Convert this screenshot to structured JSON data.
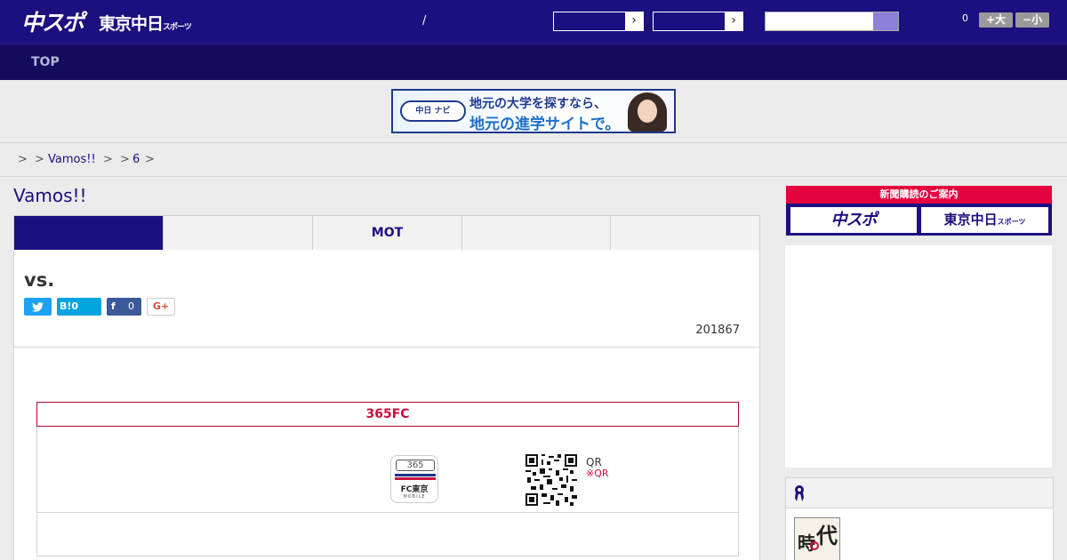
{
  "header": {
    "logo_chuspo": "中スポ",
    "logo_tokyo": "東京中日",
    "logo_tokyo_small": "スポーツ",
    "slash": "/",
    "select_arrow": "›",
    "font_size_count": "0",
    "font_up_label": "+大",
    "font_down_label": "−小"
  },
  "nav": {
    "top_label": "TOP"
  },
  "ad": {
    "logo_text": "中日 ナビ",
    "line1": "地元の大学を探すなら、",
    "line2": "地元の進学サイトで。"
  },
  "breadcrumb": {
    "sep1": ">",
    "sep2": ">",
    "vamos": "Vamos!!",
    "sep3": ">",
    "sep4": ">",
    "six": "6",
    "sep5": ">"
  },
  "page": {
    "title": "Vamos!!"
  },
  "tabs": [
    "",
    "",
    "MOT",
    "",
    ""
  ],
  "article": {
    "vs": "vs.",
    "share": {
      "twitter_icon": "twitter-icon",
      "hatena_label": "B!",
      "hatena_count": "0",
      "facebook_icon": "f",
      "facebook_count": "0",
      "gplus_label": "G+"
    },
    "date": "201867"
  },
  "app_box": {
    "title": "365FC",
    "icon_number": "365",
    "icon_text": "FC東京",
    "icon_sub": "MOBILE",
    "qr_label": "QR",
    "qr_note": "※QR"
  },
  "sidebar": {
    "subscribe_header": "新聞購読のご案内",
    "subscribe_chuspo": "中スポ",
    "subscribe_tokyo": "東京中日",
    "subscribe_tokyo_small": "スポーツ",
    "ranking_icon": "ribbon-icon",
    "thumb_char1": "時",
    "thumb_char2": "代"
  },
  "colors": {
    "brand_navy": "#1c0f80",
    "nav_dark": "#150a5e",
    "accent_red": "#c8103e",
    "subscribe_red": "#e4023f",
    "twitter_blue": "#1da1f2",
    "facebook_blue": "#3b5998"
  }
}
